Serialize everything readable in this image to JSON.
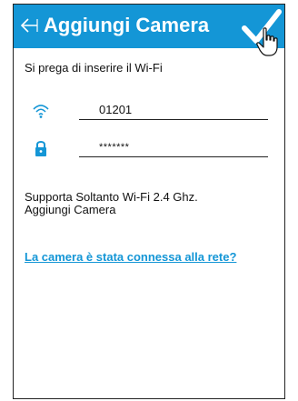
{
  "header": {
    "title": "Aggiungi Camera",
    "back_icon": "back-arrow-icon",
    "confirm_icon": "checkmark-icon",
    "pointer_icon": "hand-pointer-icon",
    "color": "#1496d6"
  },
  "prompt": "Si prega di inserire il Wi-Fi",
  "wifi": {
    "icon": "wifi-icon",
    "value": "01201"
  },
  "password": {
    "icon": "lock-icon",
    "value": "*******"
  },
  "note": {
    "line1": "Supporta Soltanto Wi-Fi 2.4 Ghz.",
    "line2": "Aggiungi Camera"
  },
  "link": {
    "label": "La camera è stata connessa alla rete?"
  },
  "accent_color": "#1496d6"
}
